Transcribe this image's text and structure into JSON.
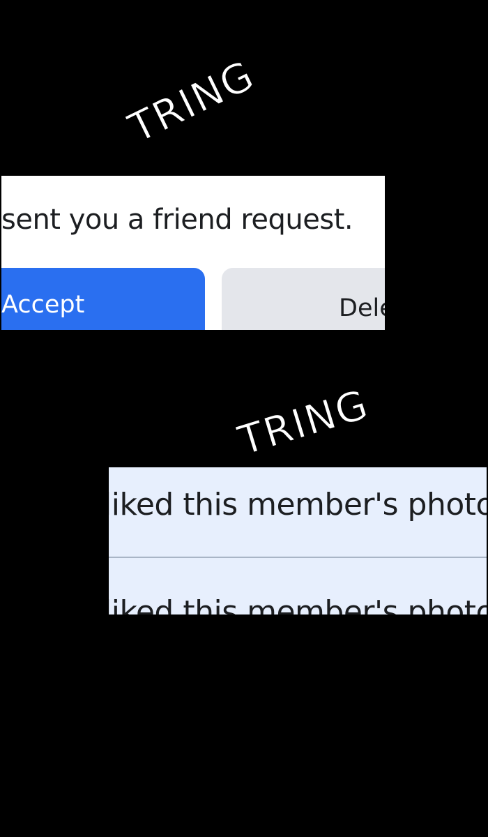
{
  "sound_effects": {
    "first": "TRING",
    "second": "TRING"
  },
  "friend_request": {
    "message": "sent you a friend request.",
    "accept_label": "Accept",
    "delete_label": "Dele",
    "accept_color": "#2a6ff0",
    "delete_color": "#e4e6eb"
  },
  "notifications": {
    "items": [
      {
        "text": "liked this member's photo"
      },
      {
        "text": "liked this member's photo"
      }
    ],
    "background_color": "#e7effd"
  }
}
